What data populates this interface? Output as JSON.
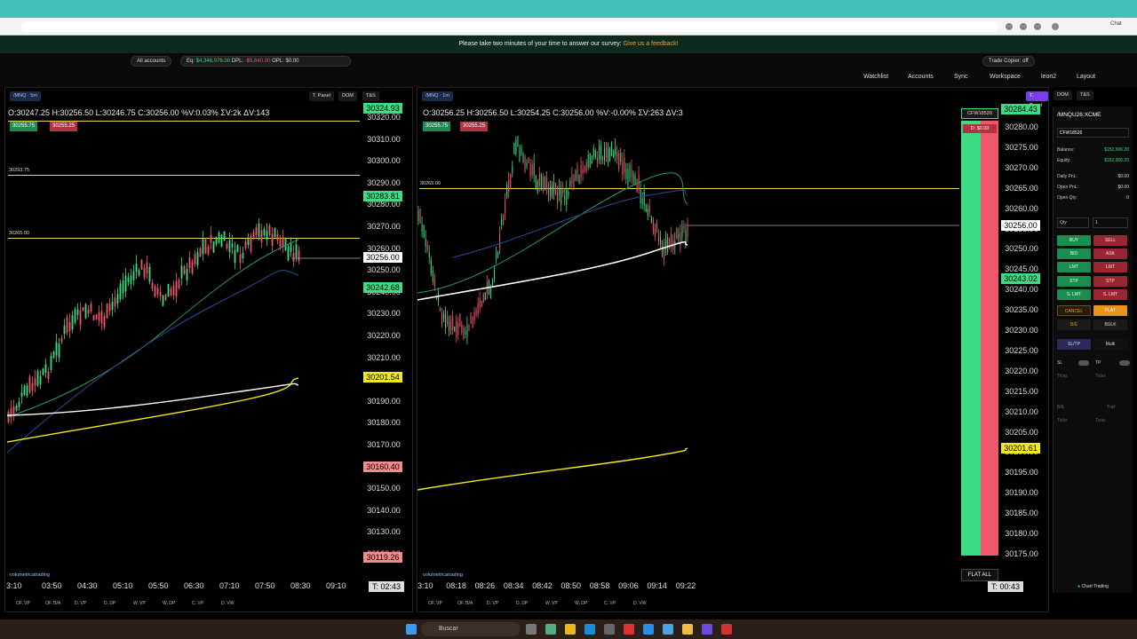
{
  "survey": {
    "text": "Please take two minutes of your time to answer our survey:",
    "link": "Give us a feedback!"
  },
  "browser": {
    "chat_label": "Chat"
  },
  "accounts_bar": {
    "all_accounts": "All accounts",
    "eq_label": "Eq:",
    "eq_value": "$4,346,076.00",
    "dpl_label": "DPL:",
    "dpl_value": "-$5,640.00",
    "opl_label": "OPL:",
    "opl_value": "$0.00",
    "trade_copier": "Trade Copier: off"
  },
  "toolbar": {
    "watchlist": "Watchlist",
    "accounts": "Accounts",
    "sync": "Sync",
    "workspace": "Workspace",
    "user": "leon2",
    "layout": "Layout"
  },
  "left_chart": {
    "symbol": "/MNQ",
    "interval": "5m",
    "tabs": [
      "T. Panel",
      "DOM",
      "T&S"
    ],
    "ohlc": "O:30247.25  H:30256.50  L:30246.75  C:30256.00  %V:0.03%  ΣV:2k  ΔV:143",
    "bid": "30255.75",
    "ask": "30255.25",
    "level_labels": [
      "30293.75",
      "30265.00"
    ],
    "y_labels": [
      "30320.00",
      "30310.00",
      "30300.00",
      "30290.00",
      "30280.00",
      "30270.00",
      "30260.00",
      "30250.00",
      "30240.00",
      "30230.00",
      "30220.00",
      "30210.00",
      "30200.00",
      "30190.00",
      "30180.00",
      "30170.00",
      "30160.00",
      "30150.00",
      "30140.00",
      "30130.00",
      "30120.00"
    ],
    "tags": {
      "top": "30324.93",
      "t1": "30283.81",
      "price": "30256.00",
      "t2": "30242.68",
      "yellow": "30201.54",
      "red1": "30160.40",
      "red2": "30119.26"
    },
    "x_labels": [
      "3:10",
      "03:50",
      "04:30",
      "05:10",
      "05:50",
      "06:30",
      "07:10",
      "07:50",
      "08:30",
      "09:10"
    ],
    "timer": "T: 02:43",
    "brand": "volumetricatrading",
    "bottom": [
      "OF. VP",
      "OF. B/A",
      "D. VP",
      "D. DP",
      "W. VP",
      "W. DP",
      "C. VP",
      "D. VW"
    ]
  },
  "right_chart": {
    "symbol": "/MNQ",
    "interval": "1m",
    "tabs": [
      "T. Panel",
      "DOM",
      "T&S"
    ],
    "ohlc": "O:30256.25  H:30256.50  L:30254.25  C:30256.00  %V:-0.00%  ΣV:263  ΔV:3",
    "bid": "30255.75",
    "ask": "30255.25",
    "level_labels": [
      "30265.00"
    ],
    "y_labels": [
      "30280.00",
      "30275.00",
      "30270.00",
      "30265.00",
      "30260.00",
      "30255.00",
      "30250.00",
      "30245.00",
      "30240.00",
      "30235.00",
      "30230.00",
      "30225.00",
      "30220.00",
      "30215.00",
      "30210.00",
      "30205.00",
      "30200.00",
      "30195.00",
      "30190.00",
      "30185.00",
      "30180.00",
      "30175.00"
    ],
    "tags": {
      "top": "30284.43",
      "price": "30256.00",
      "t2": "30243.02",
      "yellow": "30201.61"
    },
    "x_labels": [
      "3:10",
      "08:18",
      "08:26",
      "08:34",
      "08:42",
      "08:50",
      "08:58",
      "09:06",
      "09:14",
      "09:22"
    ],
    "timer": "T: 00:43",
    "brand": "volumetricatrading",
    "bottom": [
      "OF. VP",
      "OF. B/A",
      "D. VP",
      "D. DP",
      "W. VP",
      "W. DP",
      "C. VP",
      "D. VW"
    ],
    "acct_label": "CFW18526",
    "dpnl": "D: $0.00",
    "flat_all": "FLAT ALL"
  },
  "order_panel": {
    "symbol": "/MNQU26:XCME",
    "account": "CFW18526",
    "rows": [
      {
        "label": "Balance:",
        "value": "$152,906.20"
      },
      {
        "label": "Equity:",
        "value": "$152,906.20"
      },
      {
        "label": "Daily PnL:",
        "value": "$0.00"
      },
      {
        "label": "Open PnL:",
        "value": "$0.00"
      },
      {
        "label": "Open Qty:",
        "value": "0"
      }
    ],
    "qty_label": "Qty",
    "qty_value": "1",
    "buttons": [
      [
        "BUY",
        "SELL"
      ],
      [
        "BID",
        "ASK"
      ],
      [
        "LMT",
        "LMT"
      ],
      [
        "STP",
        "STP"
      ],
      [
        "S. LMT",
        "S. LMT"
      ]
    ],
    "cancel": "CANCEL",
    "flat": "FLAT",
    "be": "B/E",
    "bulk": "BULK",
    "sltp": "SL/TP",
    "multi": "Multi",
    "sl": "SL",
    "tp": "TP",
    "ticks": "Ticks",
    "trail": "Trail",
    "be2": "B/E",
    "chart_trading": "Chart Trading"
  },
  "taskbar": {
    "search": "Buscar"
  }
}
